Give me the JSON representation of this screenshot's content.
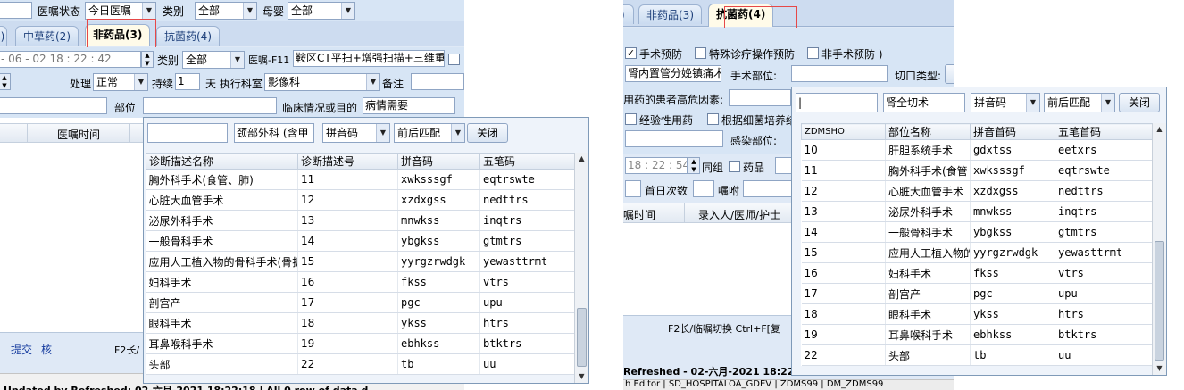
{
  "left": {
    "top_fields": {
      "order_status_label": "医嘱状态",
      "order_status_value": "今日医嘱",
      "category_label": "类别",
      "category_value": "全部",
      "mother_baby_label": "母婴",
      "mother_baby_value": "全部"
    },
    "tabs": [
      {
        "label": "中草药(2)"
      },
      {
        "label": "非药品(3)"
      },
      {
        "label": "抗菌药(4)"
      }
    ],
    "row1": {
      "datetime": "- 06 - 02    18 : 22 : 42",
      "category_label": "类别",
      "category_value": "全部",
      "order_label": "医嘱-F11",
      "order_value": "鞍区CT平扫+增强扫描+三维重建"
    },
    "row2": {
      "handle_label": "处理",
      "handle_value": "正常",
      "continuous_label": "持续",
      "continuous_value": "1",
      "dept_label": "天 执行科室",
      "dept_value": "影像科",
      "note_label": "备注"
    },
    "row3": {
      "site_label": "部位",
      "clinical_label": "临床情况或目的",
      "clinical_value": "病情需要"
    },
    "list_header_time": "医嘱时间",
    "bottom": {
      "submit": "提交",
      "verify": "核",
      "hint": "F2长/",
      "status": "Updated by Refreshed: 02-六月-2021 18:22:18 | All 0 row of data d"
    },
    "popup": {
      "search_value": "",
      "dept_value": "颈部外科 (含甲",
      "mode_value": "拼音码",
      "match_value": "前后匹配",
      "close_label": "关闭",
      "columns": [
        "诊断描述名称",
        "诊断描述号",
        "拼音码",
        "五笔码"
      ],
      "rows": [
        [
          "胸外科手术(食管、肺)",
          "11",
          "xwksssgf",
          "eqtrswte"
        ],
        [
          "心脏大血管手术",
          "12",
          "xzdxgss",
          "nedttrs"
        ],
        [
          "泌尿外科手术",
          "13",
          "mnwkss",
          "inqtrs"
        ],
        [
          "一般骨科手术",
          "14",
          "ybgkss",
          "gtmtrs"
        ],
        [
          "应用人工植入物的骨科手术(骨折",
          "15",
          "yyrgzrwdgk",
          "yewasttrmt"
        ],
        [
          "妇科手术",
          "16",
          "fkss",
          "vtrs"
        ],
        [
          "剖宫产",
          "17",
          "pgc",
          "upu"
        ],
        [
          "眼科手术",
          "18",
          "ykss",
          "htrs"
        ],
        [
          "耳鼻喉科手术",
          "19",
          "ebhkss",
          "btktrs"
        ],
        [
          "头部",
          "22",
          "tb",
          "uu"
        ]
      ]
    }
  },
  "right": {
    "tabs": [
      {
        "label": "非药品(3)"
      },
      {
        "label": "抗菌药(4)"
      }
    ],
    "checks": {
      "surgical": "手术预防",
      "special": "特殊诊疗操作预防",
      "non_surgical": "非手术预防 )"
    },
    "proc_value": "肾内置管分娩镇痛术",
    "surgery_site_label": "手术部位:",
    "incision_label": "切口类型:",
    "risk_label": "用药的患者高危因素:",
    "empirical": "经验性用药",
    "culture": "根据细菌培养结",
    "infection_site_label": "感染部位:",
    "datetime": "18 : 22 : 54",
    "same_group": "同组",
    "drug_label": "药品",
    "first_day_label": "首日次数",
    "instruct_label": "嘱咐",
    "list_header_time": "嘱时间",
    "list_header_entry": "录入人/医师/护士",
    "hint": "F2长/临嘱切换  Ctrl+F[复",
    "status": "Refreshed - 02-六月-2021 18:22:1",
    "bottom_strip": "h Editor  |  SD_HOSPITALOA_GDEV  |  ZDMS99  |  DM_ZDMS99",
    "popup": {
      "search_value": "|",
      "name_value": "肾全切术",
      "mode_value": "拼音码",
      "match_value": "前后匹配",
      "close_label": "关闭",
      "columns": [
        "ZDMSHO",
        "部位名称",
        "拼音首码",
        "五笔首码"
      ],
      "rows": [
        [
          "10",
          "肝胆系统手术",
          "gdxtss",
          "eetxrs"
        ],
        [
          "11",
          "胸外科手术(食管",
          "xwksssgf",
          "eqtrswte"
        ],
        [
          "12",
          "心脏大血管手术",
          "xzdxgss",
          "nedttrs"
        ],
        [
          "13",
          "泌尿外科手术",
          "mnwkss",
          "inqtrs"
        ],
        [
          "14",
          "一般骨科手术",
          "ybgkss",
          "gtmtrs"
        ],
        [
          "15",
          "应用人工植入物的",
          "yyrgzrwdgk",
          "yewasttrmt"
        ],
        [
          "16",
          "妇科手术",
          "fkss",
          "vtrs"
        ],
        [
          "17",
          "剖宫产",
          "pgc",
          "upu"
        ],
        [
          "18",
          "眼科手术",
          "ykss",
          "htrs"
        ],
        [
          "19",
          "耳鼻喉科手术",
          "ebhkss",
          "btktrs"
        ],
        [
          "22",
          "头部",
          "tb",
          "uu"
        ]
      ]
    }
  }
}
